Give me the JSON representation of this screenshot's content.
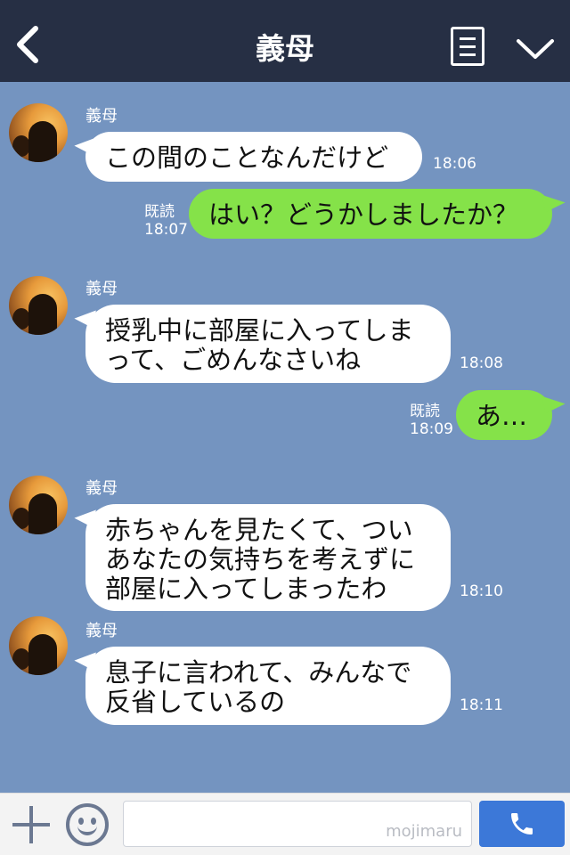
{
  "header": {
    "title": "義母",
    "back_icon": "chevron-left-icon",
    "menu_icon": "list-menu-icon",
    "collapse_icon": "chevron-down-icon"
  },
  "messages": [
    {
      "sender": "義母",
      "text": "この間のことなんだけど",
      "time": "18:06"
    },
    {
      "read": "既読",
      "time": "18:07",
      "text": "はい？どうかしましたか？"
    },
    {
      "sender": "義母",
      "text": "授乳中に部屋に入ってしま\nって、ごめんなさいね",
      "time": "18:08"
    },
    {
      "read": "既読",
      "time": "18:09",
      "text": "あ…"
    },
    {
      "sender": "義母",
      "text": "赤ちゃんを見たくて、つい\nあなたの気持ちを考えずに\n部屋に入ってしまったわ",
      "time": "18:10"
    },
    {
      "sender": "義母",
      "text": "息子に言われて、みんなで\n反省しているの",
      "time": "18:11"
    }
  ],
  "footer": {
    "plus_icon": "plus-icon",
    "emoji_icon": "smiley-icon",
    "watermark": "mojimaru",
    "send_icon": "phone-icon"
  },
  "colors": {
    "header_bg": "#262f44",
    "chat_bg": "#7494c0",
    "outgoing_bubble": "#85e249",
    "send_button": "#3c78d8"
  }
}
